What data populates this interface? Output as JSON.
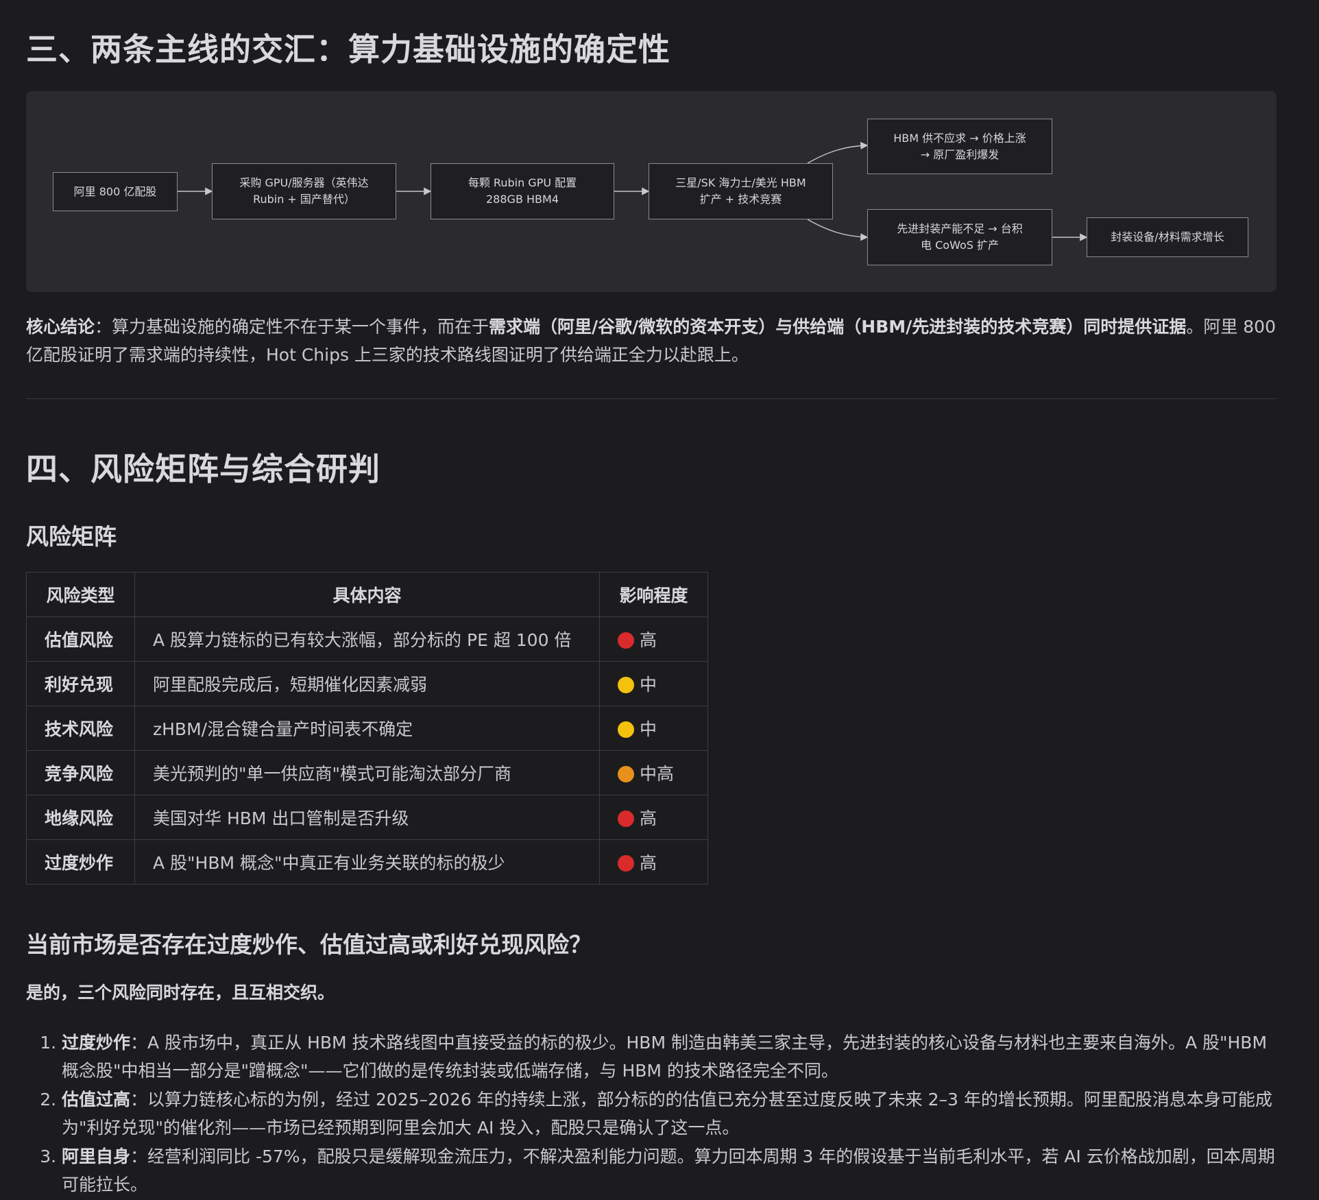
{
  "section3": {
    "title": "三、两条主线的交汇：算力基础设施的确定性"
  },
  "flow": {
    "nodes": [
      "阿里 800 亿配股",
      "采购 GPU/服务器（英伟达\nRubin + 国产替代）",
      "每颗 Rubin GPU 配置\n288GB HBM4",
      "三星/SK 海力士/美光 HBM\n扩产 + 技术竞赛",
      "HBM 供不应求 → 价格上涨\n→ 原厂盈利爆发",
      "先进封装产能不足 → 台积\n电 CoWoS 扩产",
      "封装设备/材料需求增长"
    ]
  },
  "summary": {
    "label": "核心结论",
    "sep": "：",
    "text1": "算力基础设施的确定性不在于某一个事件，而在于",
    "bold": "需求端（阿里/谷歌/微软的资本开支）与供给端（HBM/先进封装的技术竞赛）同时提供证据",
    "text2": "。阿里 800 亿配股证明了需求端的持续性，Hot Chips 上三家的技术路线图证明了供给端正全力以赴跟上。"
  },
  "section4": {
    "title": "四、风险矩阵与综合研判",
    "matrix_title": "风险矩阵"
  },
  "table": {
    "headers": [
      "风险类型",
      "具体内容",
      "影响程度"
    ],
    "rows": [
      {
        "type": "估值风险",
        "content": "A 股算力链标的已有较大涨幅，部分标的 PE 超 100 倍",
        "level": "高",
        "color": "#d92b2b"
      },
      {
        "type": "利好兑现",
        "content": "阿里配股完成后，短期催化因素减弱",
        "level": "中",
        "color": "#f4c20d"
      },
      {
        "type": "技术风险",
        "content": "zHBM/混合键合量产时间表不确定",
        "level": "中",
        "color": "#f4c20d"
      },
      {
        "type": "竞争风险",
        "content": "美光预判的\"单一供应商\"模式可能淘汰部分厂商",
        "level": "中高",
        "color": "#e8901c"
      },
      {
        "type": "地缘风险",
        "content": "美国对华 HBM 出口管制是否升级",
        "level": "高",
        "color": "#d92b2b"
      },
      {
        "type": "过度炒作",
        "content": "A 股\"HBM 概念\"中真正有业务关联的标的极少",
        "level": "高",
        "color": "#d92b2b"
      }
    ]
  },
  "question": {
    "title": "当前市场是否存在过度炒作、估值过高或利好兑现风险？",
    "answer": "是的，三个风险同时存在，且互相交织。"
  },
  "points": [
    {
      "label": "过度炒作",
      "sep": "：",
      "text": "A 股市场中，真正从 HBM 技术路线图中直接受益的标的极少。HBM 制造由韩美三家主导，先进封装的核心设备与材料也主要来自海外。A 股\"HBM 概念股\"中相当一部分是\"蹭概念\"——它们做的是传统封装或低端存储，与 HBM 的技术路径完全不同。"
    },
    {
      "label": "估值过高",
      "sep": "：",
      "text": "以算力链核心标的为例，经过 2025–2026 年的持续上涨，部分标的的估值已充分甚至过度反映了未来 2–3 年的增长预期。阿里配股消息本身可能成为\"利好兑现\"的催化剂——市场已经预期到阿里会加大 AI 投入，配股只是确认了这一点。"
    },
    {
      "label": "阿里自身",
      "sep": "：",
      "text": "经营利润同比 -57%，配股只是缓解现金流压力，不解决盈利能力问题。算力回本周期 3 年的假设基于当前毛利水平，若 AI 云价格战加剧，回本周期可能拉长。"
    }
  ]
}
